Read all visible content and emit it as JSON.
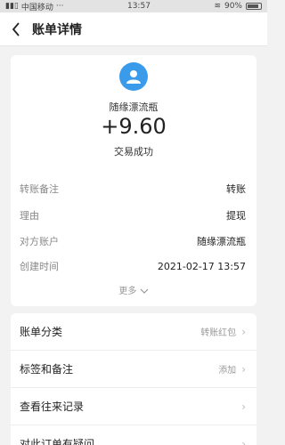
{
  "status_bar": {
    "carrier": "中国移动",
    "time": "13:57",
    "battery": "90%"
  },
  "header": {
    "title": "账单详情"
  },
  "summary": {
    "payee": "随缘漂流瓶",
    "amount": "+9.60",
    "status": "交易成功"
  },
  "details": [
    {
      "label": "转账备注",
      "value": "转账"
    },
    {
      "label": "理由",
      "value": "提现"
    },
    {
      "label": "对方账户",
      "value": "随缘漂流瓶"
    },
    {
      "label": "创建时间",
      "value": "2021-02-17 13:57"
    }
  ],
  "more_label": "更多",
  "list": [
    {
      "label": "账单分类",
      "value": "转账红包"
    },
    {
      "label": "标签和备注",
      "value": "添加"
    },
    {
      "label": "查看往来记录",
      "value": ""
    },
    {
      "label": "对此订单有疑问",
      "value": ""
    }
  ],
  "colors": {
    "accent": "#3a9bea",
    "background": "#f2f2f2"
  }
}
